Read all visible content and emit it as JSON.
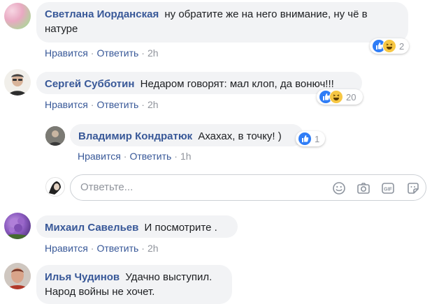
{
  "comments": [
    {
      "author": "Светлана Иорданская",
      "text": "ну обратите же на него внимание, ну чё в",
      "text2": "натуре",
      "like": "Нравится",
      "reply": "Ответить",
      "time": "2h",
      "reactions": [
        "like",
        "haha"
      ],
      "reaction_count": "2"
    },
    {
      "author": "Сергей Субботин",
      "text": "Недаром говорят: мал клоп, да вонюч!!!",
      "like": "Нравится",
      "reply": "Ответить",
      "time": "2h",
      "reactions": [
        "like",
        "haha"
      ],
      "reaction_count": "20"
    },
    {
      "author": "Владимир Кондратюк",
      "text": "Ахахах, в точку! )",
      "like": "Нравится",
      "reply": "Ответить",
      "time": "1h",
      "reactions": [
        "like"
      ],
      "reaction_count": "1"
    },
    {
      "author": "Михаил Савельев",
      "text": "И посмотрите .",
      "like": "Нравится",
      "reply": "Ответить",
      "time": "2h"
    },
    {
      "author": "Илья Чудинов",
      "text": "Удачно выступил.",
      "text2": "Народ войны не хочет."
    }
  ],
  "reply_box": {
    "placeholder": "Ответьте...",
    "icons": [
      "emoji-icon",
      "camera-icon",
      "gif-icon",
      "sticker-icon"
    ]
  },
  "colors": {
    "link": "#385898",
    "meta": "#90949c",
    "bubble": "#f2f3f5",
    "like": "#2f7df6",
    "haha": "#f7c744"
  }
}
